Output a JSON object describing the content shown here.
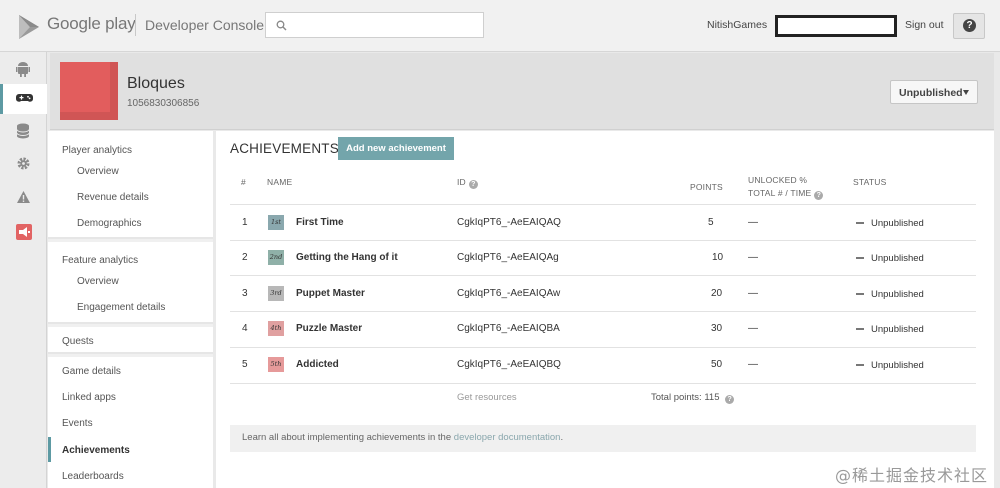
{
  "header": {
    "brand": "Google play",
    "product": "Developer Console",
    "account": "NitishGames",
    "sign_out": "Sign out",
    "help": "?"
  },
  "app": {
    "name": "Bloques",
    "id": "1056830306856",
    "publish_status": "Unpublished"
  },
  "sidebar": {
    "groups": [
      {
        "label": "Player analytics",
        "items": [
          "Overview",
          "Revenue details",
          "Demographics"
        ]
      },
      {
        "label": "Feature analytics",
        "items": [
          "Overview",
          "Engagement details"
        ]
      },
      {
        "label": "Quests",
        "items": []
      },
      {
        "label": "",
        "items": [
          "Game details",
          "Linked apps",
          "Events",
          "Achievements",
          "Leaderboards"
        ]
      }
    ],
    "active": "Achievements"
  },
  "main": {
    "title": "ACHIEVEMENTS",
    "add_button": "Add new achievement",
    "columns": {
      "num": "#",
      "name": "NAME",
      "id": "ID",
      "points": "POINTS",
      "unlocked_1": "UNLOCKED %",
      "unlocked_2": "TOTAL # / TIME",
      "status": "STATUS"
    },
    "rows": [
      {
        "num": "1",
        "badge": "1st",
        "badge_color": "#8aa8ae",
        "name": "First Time",
        "id": "CgkIqPT6_-AeEAIQAQ",
        "points": "5",
        "unlocked": "—",
        "status": "Unpublished"
      },
      {
        "num": "2",
        "badge": "2nd",
        "badge_color": "#8fb0a8",
        "name": "Getting the Hang of it",
        "id": "CgkIqPT6_-AeEAIQAg",
        "points": "10",
        "unlocked": "—",
        "status": "Unpublished"
      },
      {
        "num": "3",
        "badge": "3rd",
        "badge_color": "#b8b8b8",
        "name": "Puppet Master",
        "id": "CgkIqPT6_-AeEAIQAw",
        "points": "20",
        "unlocked": "—",
        "status": "Unpublished"
      },
      {
        "num": "4",
        "badge": "4th",
        "badge_color": "#e0a0a0",
        "name": "Puzzle Master",
        "id": "CgkIqPT6_-AeEAIQBA",
        "points": "30",
        "unlocked": "—",
        "status": "Unpublished"
      },
      {
        "num": "5",
        "badge": "5th",
        "badge_color": "#e69a9a",
        "name": "Addicted",
        "id": "CgkIqPT6_-AeEAIQBQ",
        "points": "50",
        "unlocked": "—",
        "status": "Unpublished"
      }
    ],
    "get_resources": "Get resources",
    "total_points_label": "Total points:",
    "total_points": "115",
    "learn_text": "Learn all about implementing achievements in the",
    "learn_link": "developer documentation",
    "learn_end": "."
  },
  "watermark": "@稀土掘金技术社区",
  "colors": {
    "accent": "#73a5ab",
    "active_nav": "#5d9aa3",
    "app_icon": "#e25d5d"
  },
  "icons": [
    "android-icon",
    "gamepad-icon",
    "database-icon",
    "gear-icon",
    "warning-icon",
    "megaphone-icon",
    "search-icon",
    "help-icon"
  ]
}
